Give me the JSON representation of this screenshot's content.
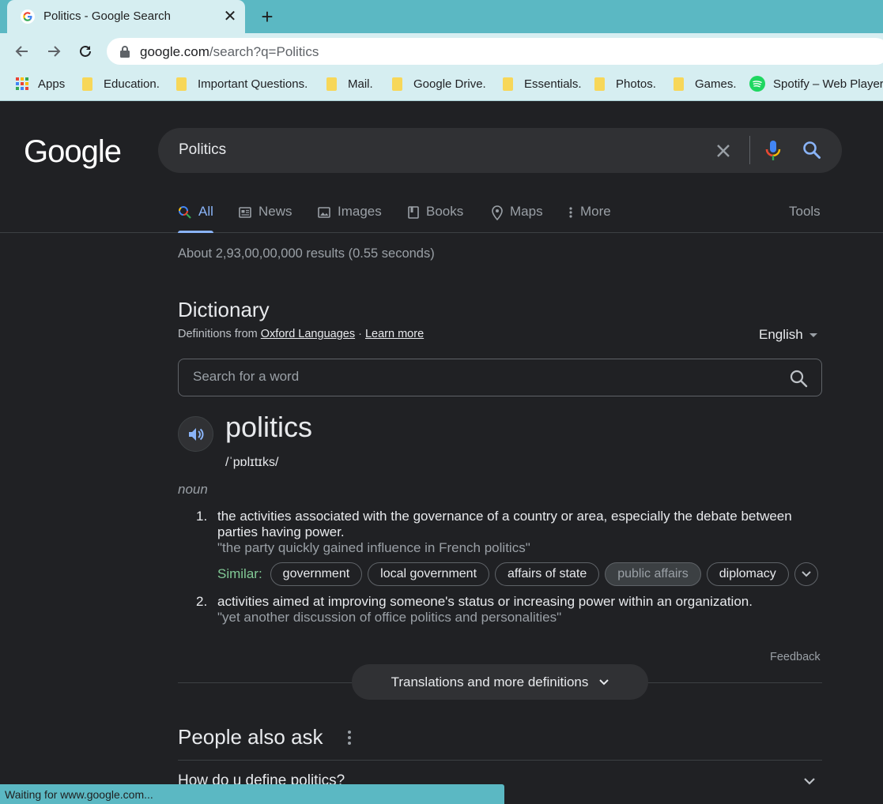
{
  "browser": {
    "tab_title": "Politics - Google Search",
    "url_host": "google.com",
    "url_path": "/search?q=Politics",
    "bookmarks": [
      {
        "label": "Apps",
        "icon": "apps-grid-icon"
      },
      {
        "label": "Education.",
        "icon": "folder-icon"
      },
      {
        "label": "Important Questions.",
        "icon": "folder-icon"
      },
      {
        "label": "Mail.",
        "icon": "folder-icon"
      },
      {
        "label": "Google Drive.",
        "icon": "folder-icon"
      },
      {
        "label": "Essentials.",
        "icon": "folder-icon"
      },
      {
        "label": "Photos.",
        "icon": "folder-icon"
      },
      {
        "label": "Games.",
        "icon": "folder-icon"
      },
      {
        "label": "Spotify – Web Player",
        "icon": "spotify-icon"
      }
    ],
    "status_text": "Waiting for www.google.com..."
  },
  "search": {
    "logo": "Google",
    "query": "Politics",
    "tabs": {
      "all": "All",
      "news": "News",
      "images": "Images",
      "books": "Books",
      "maps": "Maps",
      "more": "More"
    },
    "tools": "Tools",
    "results_count": "About 2,93,00,00,000 results (0.55 seconds)"
  },
  "dictionary": {
    "title": "Dictionary",
    "source_prefix": "Definitions from",
    "source_link": "Oxford Languages",
    "source_separator": "·",
    "learn_more": "Learn more",
    "language": "English",
    "word_search_placeholder": "Search for a word",
    "headword": "politics",
    "phonetic": "/ˈpɒlɪtɪks/",
    "part_of_speech": "noun",
    "definitions": [
      {
        "number": "1.",
        "text": "the activities associated with the governance of a country or area, especially the debate between parties having power.",
        "example": "\"the party quickly gained influence in French politics\""
      },
      {
        "number": "2.",
        "text": "activities aimed at improving someone's status or increasing power within an organization.",
        "example": "\"yet another discussion of office politics and personalities\""
      }
    ],
    "similar_label": "Similar:",
    "similar": [
      "government",
      "local government",
      "affairs of state",
      "public affairs",
      "diplomacy"
    ],
    "feedback": "Feedback",
    "translations_button": "Translations and more definitions"
  },
  "people_also_ask": {
    "title": "People also ask",
    "questions": [
      "How do u define politics?"
    ]
  },
  "colors": {
    "page_bg": "#202124",
    "chrome_teal": "#5bb8c3",
    "chrome_light": "#d6eef1",
    "link_blue": "#8ab4f8",
    "similar_green": "#81c995"
  }
}
